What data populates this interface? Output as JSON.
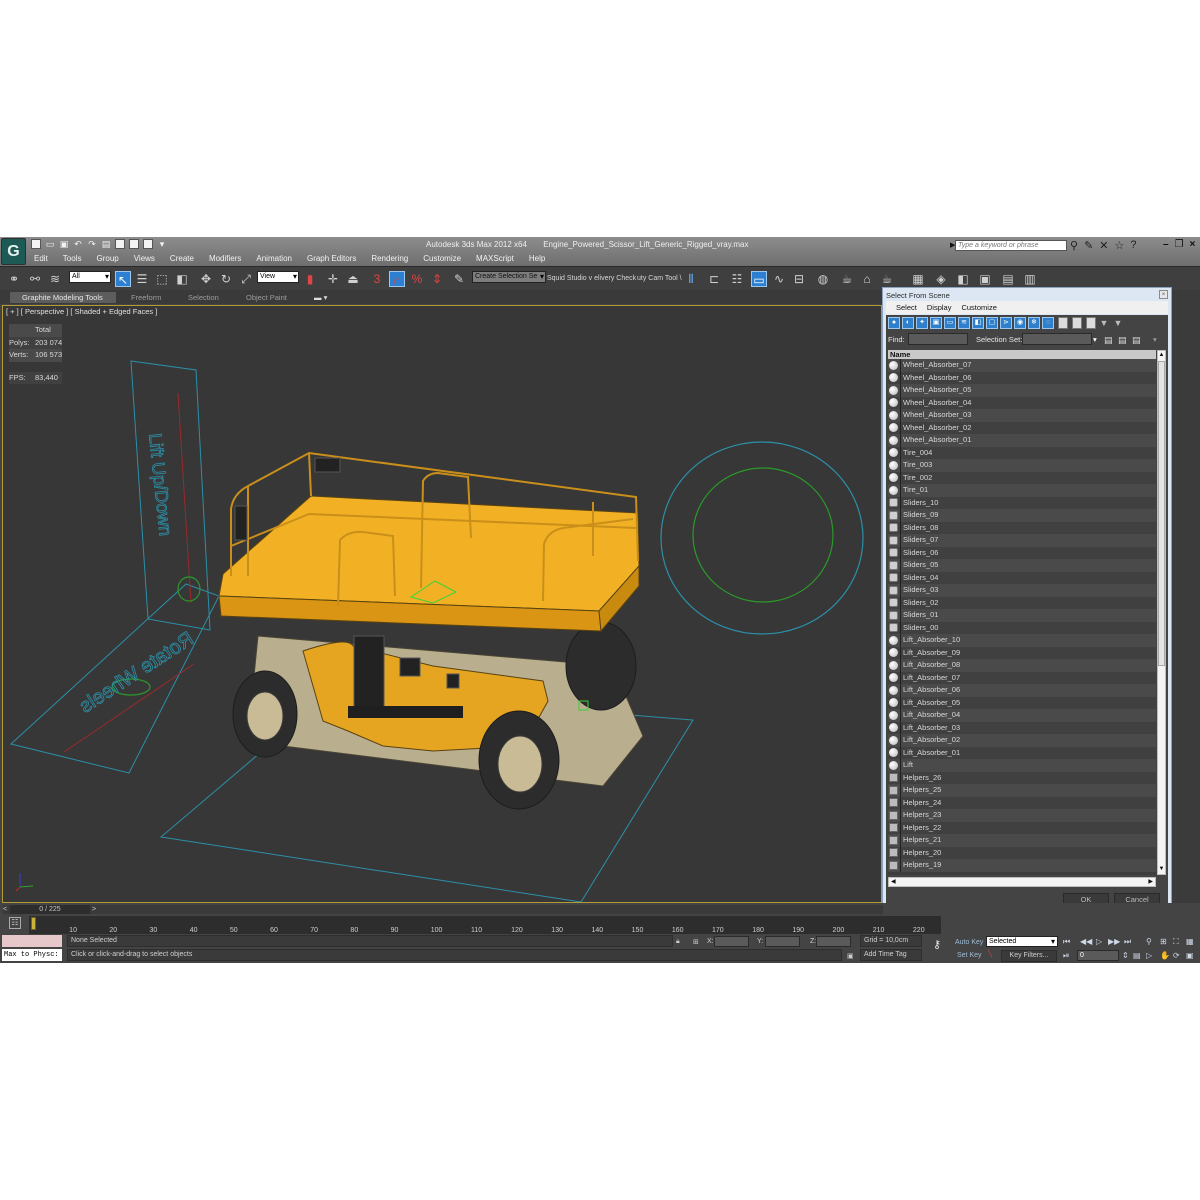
{
  "window": {
    "app_title": "Autodesk 3ds Max  2012 x64",
    "file_name": "Engine_Powered_Scissor_Lift_Generic_Rigged_vray.max",
    "search_placeholder": "Type a keyword or phrase",
    "logo_glyph": "G"
  },
  "menu": [
    "Edit",
    "Tools",
    "Group",
    "Views",
    "Create",
    "Modifiers",
    "Animation",
    "Graph Editors",
    "Rendering",
    "Customize",
    "MAXScript",
    "Help"
  ],
  "toolbar": {
    "selection_filter": "All",
    "reference_coord": "View",
    "named_selection": "Create Selection Se",
    "snap_3": "3",
    "snap_percent": "%",
    "custom_label_1": "Squid Studio v elivery Check",
    "custom_label_2": "uty Cam Tool \\"
  },
  "ribbon": {
    "tabs": [
      "Graphite Modeling Tools",
      "Freeform",
      "Selection",
      "Object Paint"
    ]
  },
  "viewport": {
    "label": "[ + ] [ Perspective ] [ Shaded + Edged Faces ]",
    "stats": {
      "total_label": "Total",
      "polys_label": "Polys:",
      "polys": "203 074",
      "verts_label": "Verts:",
      "verts": "106 573",
      "fps_label": "FPS:",
      "fps": "83,440"
    },
    "control_text_1": "Lift Up/Down",
    "control_text_2": "Rotate Wheels",
    "colors": {
      "helper": "#2c8fa8",
      "green": "#2a9a2a",
      "red": "#9a2a2a",
      "body": "#e5a520"
    }
  },
  "dialog": {
    "title": "Select From Scene",
    "menu": [
      "Select",
      "Display",
      "Customize"
    ],
    "find_label": "Find:",
    "selection_set_label": "Selection Set:",
    "column_header": "Name",
    "items": [
      {
        "name": "Wheel_Absorber_07",
        "icon": "geometry"
      },
      {
        "name": "Wheel_Absorber_06",
        "icon": "geometry"
      },
      {
        "name": "Wheel_Absorber_05",
        "icon": "geometry"
      },
      {
        "name": "Wheel_Absorber_04",
        "icon": "geometry"
      },
      {
        "name": "Wheel_Absorber_03",
        "icon": "geometry"
      },
      {
        "name": "Wheel_Absorber_02",
        "icon": "geometry"
      },
      {
        "name": "Wheel_Absorber_01",
        "icon": "geometry"
      },
      {
        "name": "Tire_004",
        "icon": "geometry"
      },
      {
        "name": "Tire_003",
        "icon": "geometry"
      },
      {
        "name": "Tire_002",
        "icon": "geometry"
      },
      {
        "name": "Tire_01",
        "icon": "geometry"
      },
      {
        "name": "Sliders_10",
        "icon": "group"
      },
      {
        "name": "Sliders_09",
        "icon": "group"
      },
      {
        "name": "Sliders_08",
        "icon": "group"
      },
      {
        "name": "Sliders_07",
        "icon": "group"
      },
      {
        "name": "Sliders_06",
        "icon": "group"
      },
      {
        "name": "Sliders_05",
        "icon": "group"
      },
      {
        "name": "Sliders_04",
        "icon": "group"
      },
      {
        "name": "Sliders_03",
        "icon": "group"
      },
      {
        "name": "Sliders_02",
        "icon": "group"
      },
      {
        "name": "Sliders_01",
        "icon": "group"
      },
      {
        "name": "Sliders_00",
        "icon": "group"
      },
      {
        "name": "Lift_Absorber_10",
        "icon": "geometry"
      },
      {
        "name": "Lift_Absorber_09",
        "icon": "geometry"
      },
      {
        "name": "Lift_Absorber_08",
        "icon": "geometry"
      },
      {
        "name": "Lift_Absorber_07",
        "icon": "geometry"
      },
      {
        "name": "Lift_Absorber_06",
        "icon": "geometry"
      },
      {
        "name": "Lift_Absorber_05",
        "icon": "geometry"
      },
      {
        "name": "Lift_Absorber_04",
        "icon": "geometry"
      },
      {
        "name": "Lift_Absorber_03",
        "icon": "geometry"
      },
      {
        "name": "Lift_Absorber_02",
        "icon": "geometry"
      },
      {
        "name": "Lift_Absorber_01",
        "icon": "geometry"
      },
      {
        "name": "Lift",
        "icon": "geometry"
      },
      {
        "name": "Helpers_26",
        "icon": "helper"
      },
      {
        "name": "Helpers_25",
        "icon": "helper"
      },
      {
        "name": "Helpers_24",
        "icon": "helper"
      },
      {
        "name": "Helpers_23",
        "icon": "helper"
      },
      {
        "name": "Helpers_22",
        "icon": "helper"
      },
      {
        "name": "Helpers_21",
        "icon": "helper"
      },
      {
        "name": "Helpers_20",
        "icon": "helper"
      },
      {
        "name": "Helpers_19",
        "icon": "helper"
      }
    ],
    "ok_label": "OK",
    "cancel_label": "Cancel"
  },
  "timeline": {
    "frame_display": "0 / 225",
    "prev": "<",
    "next": ">",
    "ticks": [
      "10",
      "20",
      "30",
      "40",
      "50",
      "60",
      "70",
      "80",
      "90",
      "100",
      "110",
      "120",
      "130",
      "140",
      "150",
      "160",
      "170",
      "180",
      "190",
      "200",
      "210",
      "220"
    ],
    "current_frame": 0,
    "total_frames": 225
  },
  "status": {
    "maxscript_listener": "Max to Physc:",
    "selection_status": "None Selected",
    "prompt": "Click or click-and-drag to select objects",
    "x_label": "X:",
    "y_label": "Y:",
    "z_label": "Z:",
    "grid": "Grid = 10,0cm",
    "add_time_tag": "Add Time Tag",
    "auto_key": "Auto Key",
    "set_key": "Set Key",
    "key_mode": "Selected",
    "key_filters": "Key Filters...",
    "frame_value": "0"
  }
}
